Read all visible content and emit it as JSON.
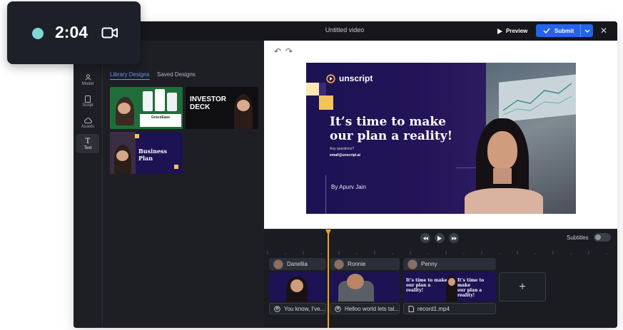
{
  "recorder": {
    "time": "2:04",
    "camera_icon": "video-camera-icon"
  },
  "app": {
    "title": "Untitled video",
    "preview_label": "Preview",
    "submit_label": "Submit"
  },
  "rail": {
    "items": [
      {
        "label": "Model",
        "icon": "person-icon"
      },
      {
        "label": "Script",
        "icon": "document-icon"
      },
      {
        "label": "Assets",
        "icon": "cloud-upload-icon"
      },
      {
        "label": "Text",
        "icon": "text-icon"
      }
    ]
  },
  "panel": {
    "title": "gn",
    "tabs": [
      {
        "label": "Library Designs",
        "active": true
      },
      {
        "label": "Saved Designs",
        "active": false
      }
    ],
    "thumbs": [
      {
        "title": "GroceEase"
      },
      {
        "title": "INVESTOR DECK"
      },
      {
        "title": "Business Plan"
      }
    ]
  },
  "slide": {
    "brand": "unscript",
    "headline_line1": "It’s time to make",
    "headline_line2": "our plan a reality!",
    "question": "Any questions?",
    "email": "email@unscript.ai",
    "byline": "By Apurv Jain"
  },
  "timeline": {
    "subtitles_label": "Subtitles",
    "subtitles_on": false,
    "clips": [
      {
        "name": "Danellia",
        "caption": "You know, I've..."
      },
      {
        "name": "Ronnie",
        "caption": "Helloo world lets tal..."
      },
      {
        "name": "Penny",
        "caption": "record1.mp4"
      }
    ],
    "add_label": "+"
  },
  "colors": {
    "accent": "#2463eb",
    "playhead": "#f0a323",
    "recorder_dot": "#7fd6d3",
    "slide_bg": "#1c1254",
    "logo_square": "#f4c35a"
  }
}
